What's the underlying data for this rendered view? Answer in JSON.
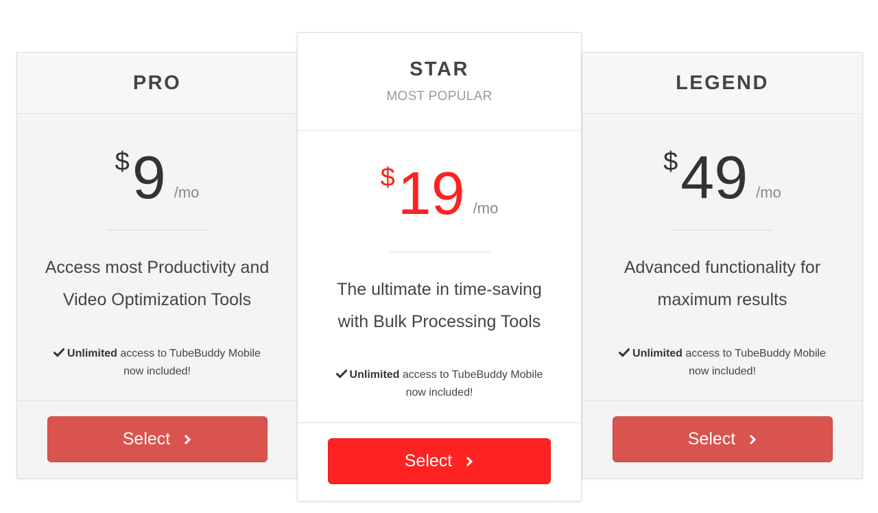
{
  "colors": {
    "accent_red": "#fe2222",
    "button_red": "#d9534f",
    "text_dark": "#333333",
    "text_muted": "#9a9a9a"
  },
  "plans": [
    {
      "name": "PRO",
      "tag": "",
      "currency": "$",
      "amount": "9",
      "unit": "/mo",
      "tagline_line1": "Access most Productivity and",
      "tagline_line2": "Video Optimization Tools",
      "feature_bold": "Unlimited",
      "feature_rest": " access to TubeBuddy Mobile",
      "feature_line2": "now included!",
      "check_icon": "checkmark-icon",
      "button_label": "Select",
      "button_icon": "chevron-right-icon"
    },
    {
      "name": "STAR",
      "tag": "MOST POPULAR",
      "currency": "$",
      "amount": "19",
      "unit": "/mo",
      "tagline_line1": "The ultimate in time-saving",
      "tagline_line2": "with Bulk Processing Tools",
      "feature_bold": "Unlimited",
      "feature_rest": " access to TubeBuddy Mobile",
      "feature_line2": "now included!",
      "check_icon": "checkmark-icon",
      "button_label": "Select",
      "button_icon": "chevron-right-icon"
    },
    {
      "name": "LEGEND",
      "tag": "",
      "currency": "$",
      "amount": "49",
      "unit": "/mo",
      "tagline_line1": "Advanced functionality for",
      "tagline_line2": "maximum results",
      "feature_bold": "Unlimited",
      "feature_rest": " access to TubeBuddy Mobile",
      "feature_line2": "now included!",
      "check_icon": "checkmark-icon",
      "button_label": "Select",
      "button_icon": "chevron-right-icon"
    }
  ]
}
